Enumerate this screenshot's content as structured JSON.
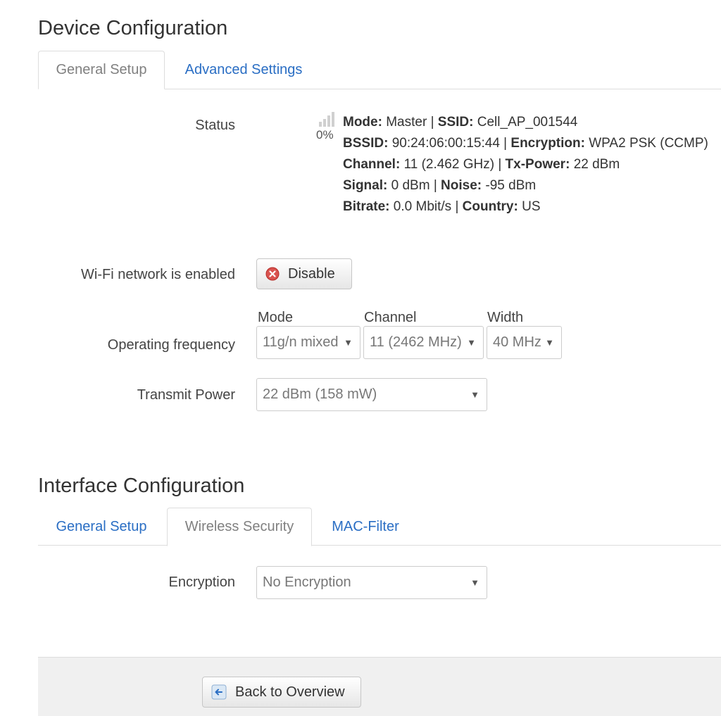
{
  "device_config": {
    "title": "Device Configuration",
    "tabs": [
      {
        "label": "General Setup",
        "active": true
      },
      {
        "label": "Advanced Settings",
        "active": false
      }
    ],
    "status": {
      "label": "Status",
      "signal_percent": "0%",
      "mode_key": "Mode:",
      "mode": "Master",
      "ssid_key": "SSID:",
      "ssid": "Cell_AP_001544",
      "bssid_key": "BSSID:",
      "bssid": "90:24:06:00:15:44",
      "encryption_key": "Encryption:",
      "encryption": "WPA2 PSK (CCMP)",
      "channel_key": "Channel:",
      "channel": "11 (2.462 GHz)",
      "txpower_key": "Tx-Power:",
      "txpower": "22 dBm",
      "signal_key": "Signal:",
      "signal": "0 dBm",
      "noise_key": "Noise:",
      "noise": "-95 dBm",
      "bitrate_key": "Bitrate:",
      "bitrate": "0.0 Mbit/s",
      "country_key": "Country:",
      "country": "US",
      "separator": " | "
    },
    "wifi_enabled": {
      "label": "Wi-Fi network is enabled",
      "button_label": "Disable",
      "button_icon": "disable-icon"
    },
    "operating_frequency": {
      "label": "Operating frequency",
      "mode_label": "Mode",
      "mode_value": "11g/n mixed",
      "channel_label": "Channel",
      "channel_value": "11 (2462 MHz)",
      "width_label": "Width",
      "width_value": "40 MHz"
    },
    "transmit_power": {
      "label": "Transmit Power",
      "value": "22 dBm (158 mW)"
    }
  },
  "interface_config": {
    "title": "Interface Configuration",
    "tabs": [
      {
        "label": "General Setup",
        "active": false
      },
      {
        "label": "Wireless Security",
        "active": true
      },
      {
        "label": "MAC-Filter",
        "active": false
      }
    ],
    "encryption": {
      "label": "Encryption",
      "value": "No Encryption"
    }
  },
  "footer": {
    "back_button_label": "Back to Overview",
    "back_button_icon": "back-arrow-icon"
  },
  "colors": {
    "link": "#2a6ec4",
    "disable_icon": "#d9534f",
    "footer_bg": "#f0f0f0"
  }
}
